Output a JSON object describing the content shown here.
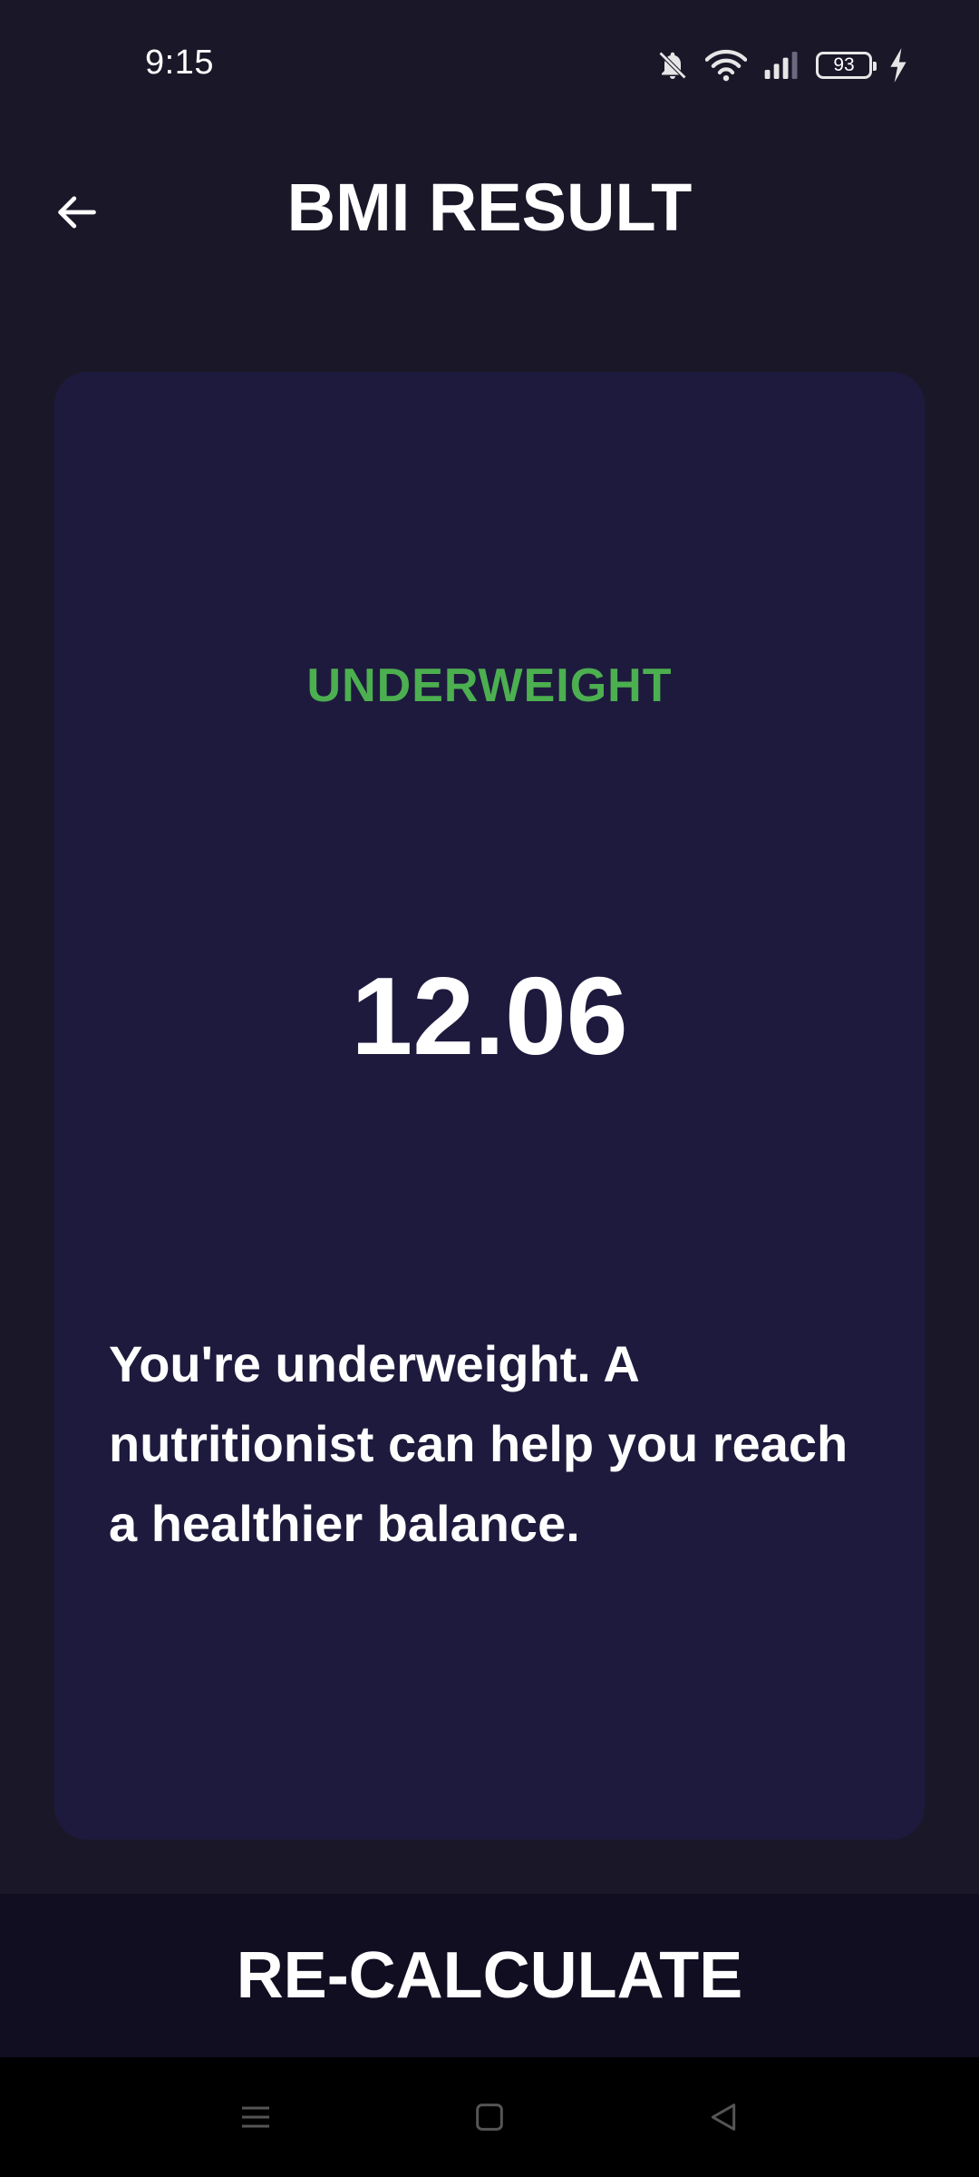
{
  "status_bar": {
    "time": "9:15",
    "battery_level": "93",
    "icons": [
      "notifications-muted-icon",
      "wifi-icon",
      "signal-icon",
      "battery-icon",
      "charging-icon"
    ]
  },
  "app_bar": {
    "title": "BMI RESULT",
    "back_icon": "arrow-left-icon"
  },
  "result": {
    "category": "UNDERWEIGHT",
    "bmi_value": "12.06",
    "message": "You're underweight. A nutritionist can help you reach a healthier balance."
  },
  "actions": {
    "recalculate_label": "RE-CALCULATE"
  },
  "nav_bar": {
    "buttons": [
      "menu-icon",
      "home-icon",
      "back-icon"
    ]
  },
  "colors": {
    "background": "#1a1728",
    "card": "#1e1a3d",
    "category": "#4caf50",
    "button_background": "#110e22",
    "text": "#ffffff"
  }
}
